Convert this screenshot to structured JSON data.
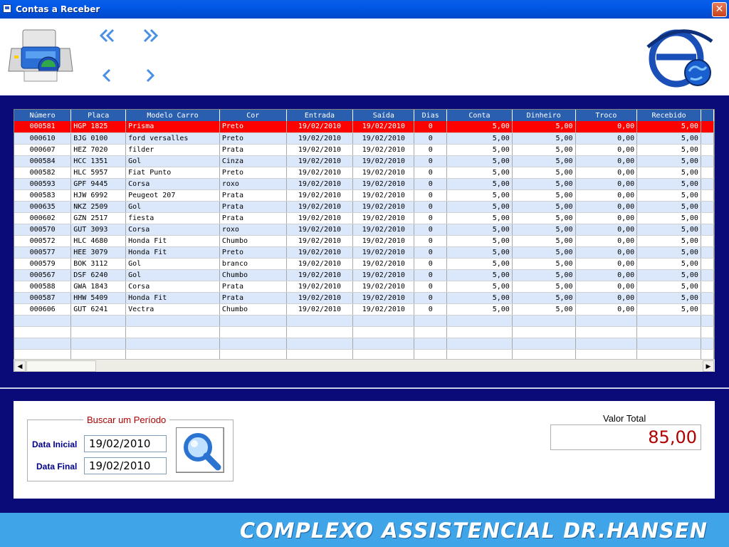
{
  "window": {
    "title": "Contas a Receber",
    "close_label": "✕"
  },
  "grid": {
    "columns": [
      "Número",
      "Placa",
      "Modelo Carro",
      "Cor",
      "Entrada",
      "Saída",
      "Dias",
      "Conta",
      "Dinheiro",
      "Troco",
      "Recebido"
    ],
    "rows": [
      [
        "000581",
        "HGP 1825",
        "Prisma",
        "Preto",
        "19/02/2010",
        "19/02/2010",
        "0",
        "5,00",
        "5,00",
        "0,00",
        "5,00"
      ],
      [
        "000610",
        "BJG 0100",
        "ford versalles",
        "Preto",
        "19/02/2010",
        "19/02/2010",
        "0",
        "5,00",
        "5,00",
        "0,00",
        "5,00"
      ],
      [
        "000607",
        "HEZ 7020",
        "filder",
        "Prata",
        "19/02/2010",
        "19/02/2010",
        "0",
        "5,00",
        "5,00",
        "0,00",
        "5,00"
      ],
      [
        "000584",
        "HCC 1351",
        "Gol",
        "Cinza",
        "19/02/2010",
        "19/02/2010",
        "0",
        "5,00",
        "5,00",
        "0,00",
        "5,00"
      ],
      [
        "000582",
        "HLC 5957",
        "Fiat Punto",
        "Preto",
        "19/02/2010",
        "19/02/2010",
        "0",
        "5,00",
        "5,00",
        "0,00",
        "5,00"
      ],
      [
        "000593",
        "GPF 9445",
        "Corsa",
        "roxo",
        "19/02/2010",
        "19/02/2010",
        "0",
        "5,00",
        "5,00",
        "0,00",
        "5,00"
      ],
      [
        "000583",
        "HJW 6992",
        "Peugeot 207",
        "Prata",
        "19/02/2010",
        "19/02/2010",
        "0",
        "5,00",
        "5,00",
        "0,00",
        "5,00"
      ],
      [
        "000635",
        "NKZ 2509",
        "Gol",
        "Prata",
        "19/02/2010",
        "19/02/2010",
        "0",
        "5,00",
        "5,00",
        "0,00",
        "5,00"
      ],
      [
        "000602",
        "GZN 2517",
        "fiesta",
        "Prata",
        "19/02/2010",
        "19/02/2010",
        "0",
        "5,00",
        "5,00",
        "0,00",
        "5,00"
      ],
      [
        "000570",
        "GUT 3093",
        "Corsa",
        "roxo",
        "19/02/2010",
        "19/02/2010",
        "0",
        "5,00",
        "5,00",
        "0,00",
        "5,00"
      ],
      [
        "000572",
        "HLC 4680",
        "Honda Fit",
        "Chumbo",
        "19/02/2010",
        "19/02/2010",
        "0",
        "5,00",
        "5,00",
        "0,00",
        "5,00"
      ],
      [
        "000577",
        "HEE 3079",
        "Honda Fit",
        "Preto",
        "19/02/2010",
        "19/02/2010",
        "0",
        "5,00",
        "5,00",
        "0,00",
        "5,00"
      ],
      [
        "000579",
        "BOK 3112",
        "Gol",
        "branco",
        "19/02/2010",
        "19/02/2010",
        "0",
        "5,00",
        "5,00",
        "0,00",
        "5,00"
      ],
      [
        "000567",
        "DSF 6240",
        "Gol",
        "Chumbo",
        "19/02/2010",
        "19/02/2010",
        "0",
        "5,00",
        "5,00",
        "0,00",
        "5,00"
      ],
      [
        "000588",
        "GWA 1843",
        "Corsa",
        "Prata",
        "19/02/2010",
        "19/02/2010",
        "0",
        "5,00",
        "5,00",
        "0,00",
        "5,00"
      ],
      [
        "000587",
        "HHW 5409",
        "Honda Fit",
        "Prata",
        "19/02/2010",
        "19/02/2010",
        "0",
        "5,00",
        "5,00",
        "0,00",
        "5,00"
      ],
      [
        "000606",
        "GUT 6241",
        "Vectra",
        "Chumbo",
        "19/02/2010",
        "19/02/2010",
        "0",
        "5,00",
        "5,00",
        "0,00",
        "5,00"
      ]
    ],
    "empty_rows": 4,
    "selected_row": 0
  },
  "search": {
    "group_title": "Buscar um Período",
    "start_label": "Data Inicial",
    "start_value": "19/02/2010",
    "end_label": "Data Final",
    "end_value": "19/02/2010"
  },
  "total": {
    "label": "Valor Total",
    "value": "85,00"
  },
  "footer": {
    "brand": "COMPLEXO ASSISTENCIAL DR.HANSEN"
  },
  "colors": {
    "accent_blue": "#0a0a78",
    "header_blue": "#2a5fb0",
    "selected_red": "#ff0000",
    "total_red": "#b00000",
    "footer_blue": "#40a4e8"
  }
}
